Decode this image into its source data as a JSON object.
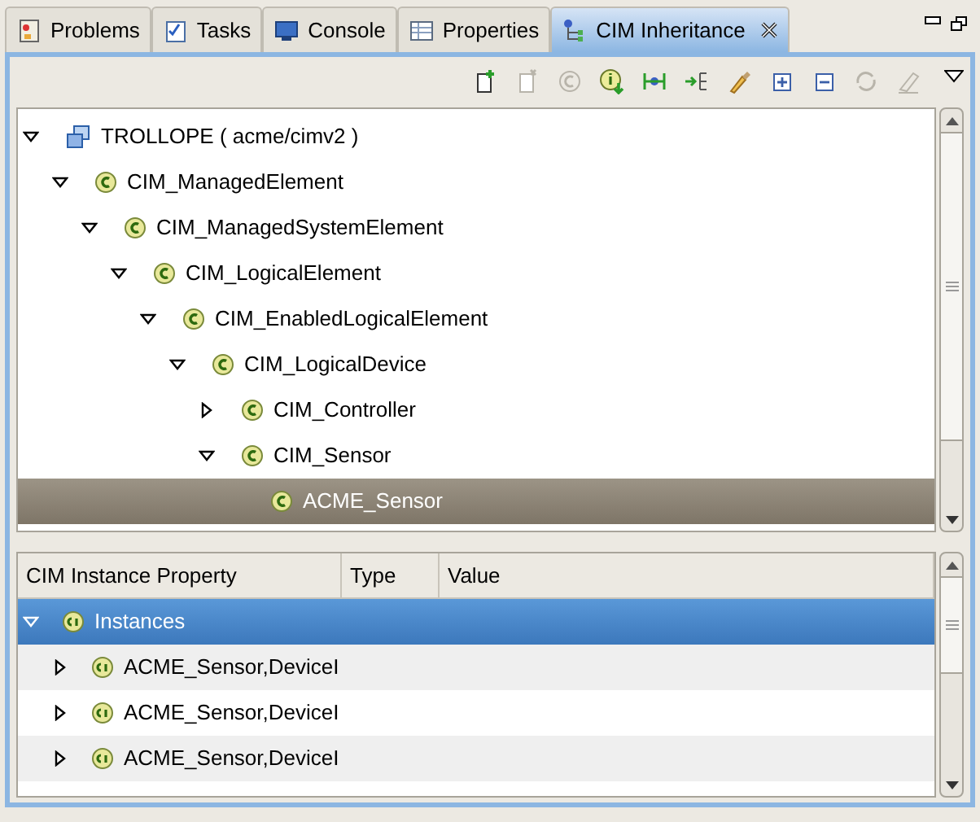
{
  "tabs": [
    {
      "label": "Problems",
      "kind": "problems",
      "selected": false
    },
    {
      "label": "Tasks",
      "kind": "tasks",
      "selected": false
    },
    {
      "label": "Console",
      "kind": "console",
      "selected": false
    },
    {
      "label": "Properties",
      "kind": "properties",
      "selected": false
    },
    {
      "label": "CIM Inheritance",
      "kind": "hierarchy",
      "selected": true,
      "closable": true
    }
  ],
  "toolbar": [
    {
      "kind": "new-file",
      "disabled": false
    },
    {
      "kind": "delete-file",
      "disabled": true
    },
    {
      "kind": "class",
      "disabled": true
    },
    {
      "kind": "info",
      "disabled": false
    },
    {
      "kind": "tree",
      "disabled": false
    },
    {
      "kind": "import",
      "disabled": false
    },
    {
      "kind": "brush",
      "disabled": false
    },
    {
      "kind": "expand",
      "disabled": false
    },
    {
      "kind": "collapse",
      "disabled": false
    },
    {
      "kind": "sync",
      "disabled": true
    },
    {
      "kind": "eraser",
      "disabled": true
    }
  ],
  "tree": [
    {
      "label": "TROLLOPE ( acme/cimv2 )",
      "kind": "host",
      "expanded": true,
      "selected": false,
      "children": [
        {
          "label": "CIM_ManagedElement",
          "kind": "class",
          "expanded": true,
          "selected": false,
          "children": [
            {
              "label": "CIM_ManagedSystemElement",
              "kind": "class",
              "expanded": true,
              "selected": false,
              "children": [
                {
                  "label": "CIM_LogicalElement",
                  "kind": "class",
                  "expanded": true,
                  "selected": false,
                  "children": [
                    {
                      "label": "CIM_EnabledLogicalElement",
                      "kind": "class",
                      "expanded": true,
                      "selected": false,
                      "children": [
                        {
                          "label": "CIM_LogicalDevice",
                          "kind": "class",
                          "expanded": true,
                          "selected": false,
                          "children": [
                            {
                              "label": "CIM_Controller",
                              "kind": "class",
                              "expanded": false,
                              "selected": false
                            },
                            {
                              "label": "CIM_Sensor",
                              "kind": "class",
                              "expanded": true,
                              "selected": false,
                              "children": [
                                {
                                  "label": "ACME_Sensor",
                                  "kind": "class",
                                  "selected": true
                                }
                              ]
                            }
                          ]
                        }
                      ]
                    }
                  ]
                }
              ]
            }
          ]
        }
      ]
    }
  ],
  "table": {
    "columns": [
      "CIM Instance Property",
      "Type",
      "Value"
    ],
    "rows": [
      {
        "label": "Instances",
        "expanded": true,
        "selected": true,
        "children": [
          {
            "label": "ACME_Sensor,DeviceI",
            "expanded": false,
            "selected": false
          },
          {
            "label": "ACME_Sensor,DeviceI",
            "expanded": false,
            "selected": false
          },
          {
            "label": "ACME_Sensor,DeviceI",
            "expanded": false,
            "selected": false
          }
        ]
      }
    ]
  }
}
